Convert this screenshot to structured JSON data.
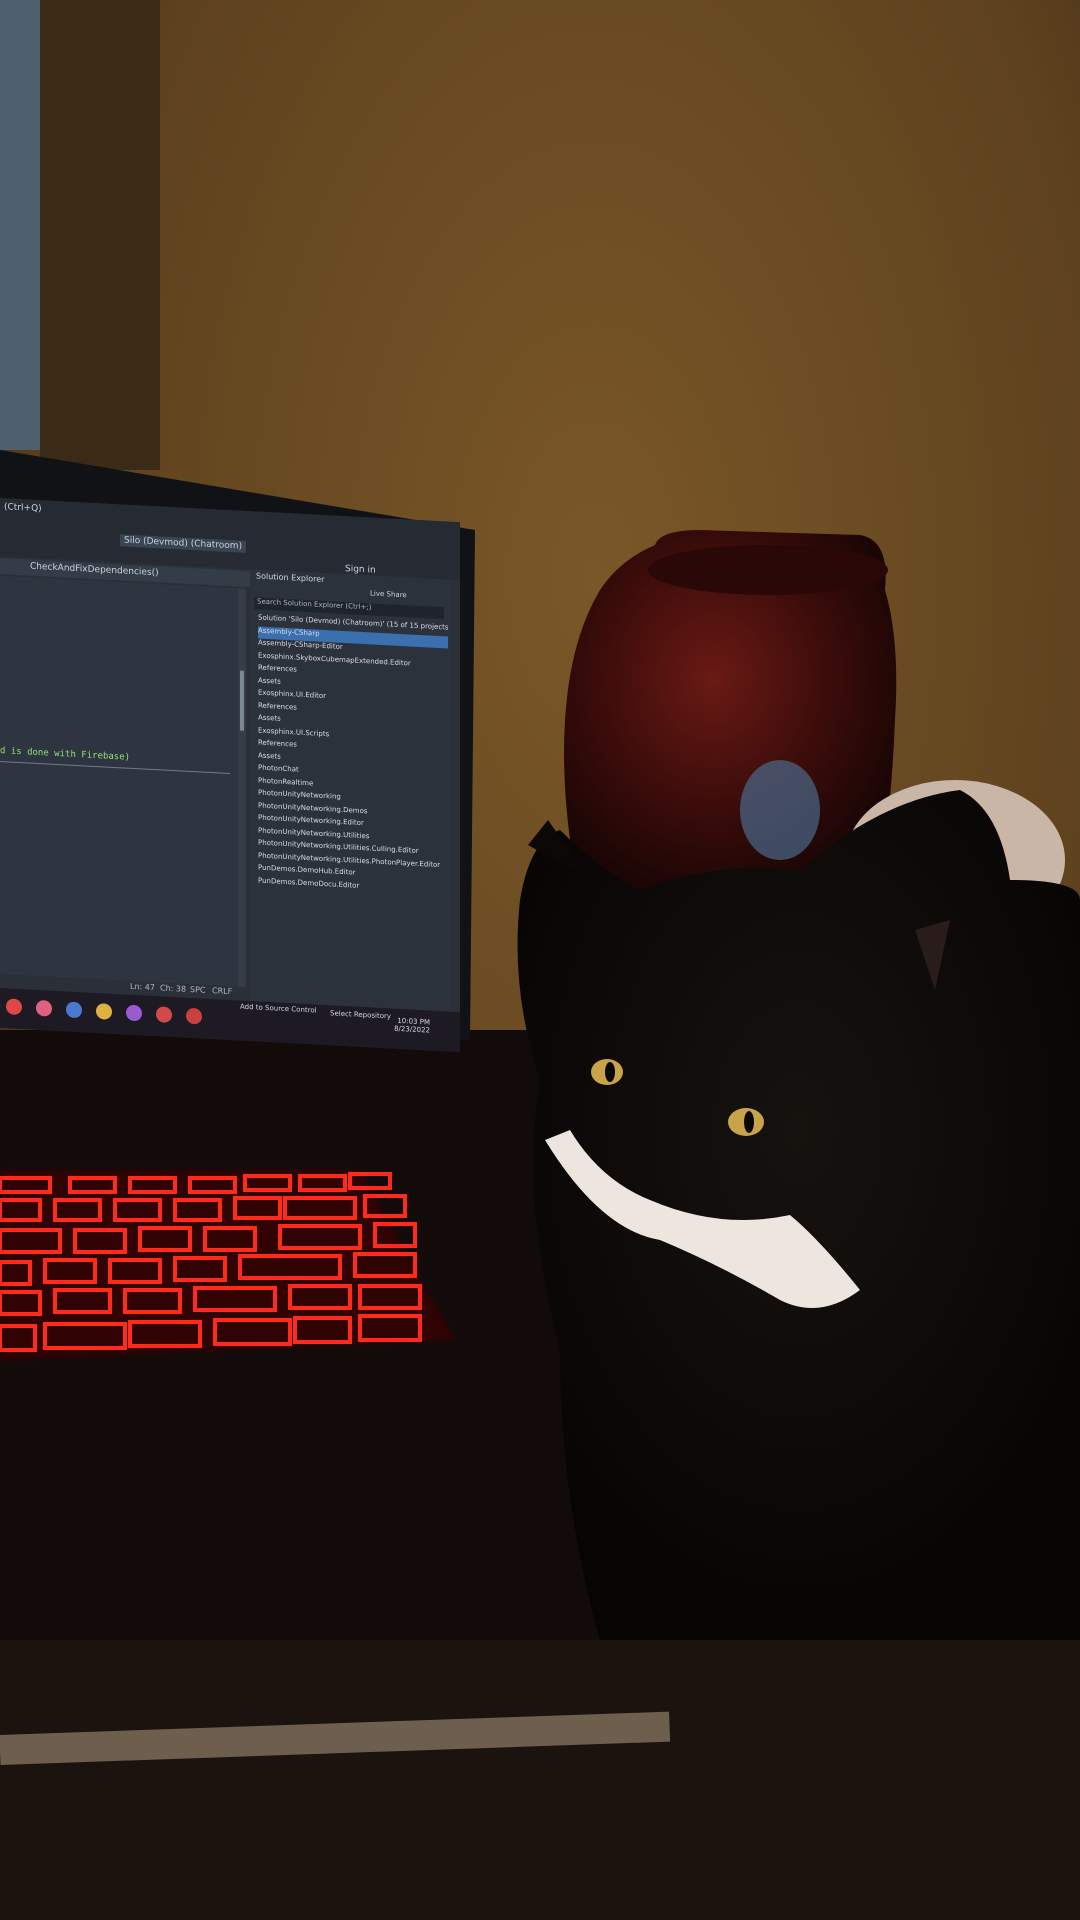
{
  "scene": {
    "description_objects": [
      "laptop",
      "monitor",
      "cat",
      "vase",
      "keyboard",
      "teapot"
    ]
  },
  "ide": {
    "search_hint": "(Ctrl+Q)",
    "project_name": "Silo (Devmod) (Chatroom)",
    "sign_in": "Sign in",
    "live_share": "Live Share",
    "tab_label": "CheckAndFixDependencies()",
    "code_text": "d is done with Firebase)",
    "status": {
      "line": "Ln: 47",
      "col": "Ch: 38",
      "spc": "SPC",
      "crlf": "CRLF"
    },
    "solution_explorer": {
      "title": "Solution Explorer",
      "search": "Search Solution Explorer (Ctrl+;)",
      "items": [
        "Solution 'Silo (Devmod) (Chatroom)' (15 of 15 projects)",
        "Assembly-CSharp",
        "Assembly-CSharp-Editor",
        "Exosphinx.SkyboxCubemapExtended.Editor",
        "References",
        "Assets",
        "Exosphinx.UI.Editor",
        "References",
        "Assets",
        "Exosphinx.UI.Scripts",
        "References",
        "Assets",
        "PhotonChat",
        "PhotonRealtime",
        "PhotonUnityNetworking",
        "PhotonUnityNetworking.Demos",
        "PhotonUnityNetworking.Editor",
        "PhotonUnityNetworking.Utilities",
        "PhotonUnityNetworking.Utilities.Culling.Editor",
        "PhotonUnityNetworking.Utilities.PhotonPlayer.Editor",
        "PunDemos.DemoHub.Editor",
        "PunDemos.DemoDocu.Editor"
      ]
    },
    "bottom_bar": {
      "source_control": "Add to Source Control",
      "repository": "Select Repository"
    },
    "clock": {
      "time": "10:03 PM",
      "date": "8/23/2022"
    }
  },
  "colors": {
    "wall": "#6b4b22",
    "keyboard_glow": "#ff2a1a",
    "vase": "#3a0c0a"
  }
}
